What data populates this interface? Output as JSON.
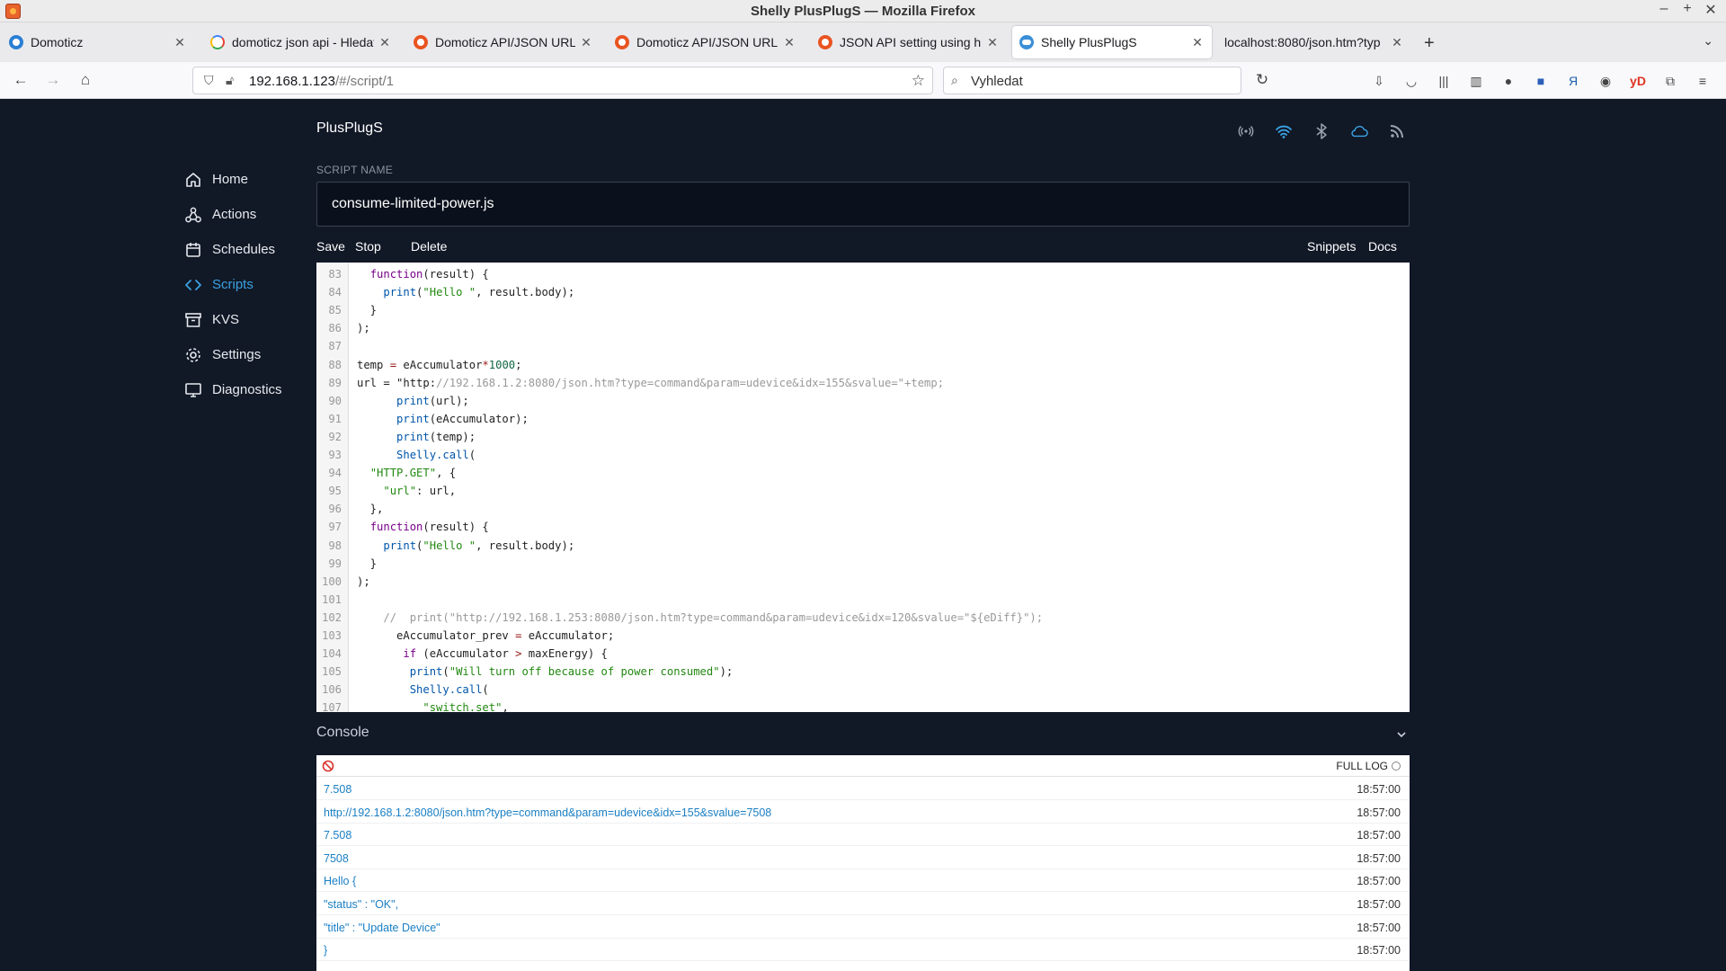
{
  "window": {
    "title": "Shelly PlusPlugS — Mozilla Firefox",
    "controls": [
      "–",
      "+",
      "✕"
    ]
  },
  "tabs": [
    {
      "title": "Domoticz",
      "favicon": "domoticz-icon"
    },
    {
      "title": "domoticz json api - Hledat",
      "favicon": "google-icon"
    },
    {
      "title": "Domoticz API/JSON URL",
      "favicon": "ubuntu-icon"
    },
    {
      "title": "Domoticz API/JSON URL",
      "favicon": "ubuntu-icon"
    },
    {
      "title": "JSON API setting using h",
      "favicon": "ubuntu-icon"
    },
    {
      "title": "Shelly PlusPlugS",
      "favicon": "shelly-icon",
      "active": true
    },
    {
      "title": "localhost:8080/json.htm?typ",
      "favicon": "none"
    }
  ],
  "address": {
    "host": "192.168.1.123",
    "path": "/#/script/1"
  },
  "search": {
    "placeholder": "Vyhledat"
  },
  "app": {
    "device_name": "PlusPlugS",
    "sidebar": [
      {
        "label": "Home",
        "icon": "home-icon"
      },
      {
        "label": "Actions",
        "icon": "actions-icon"
      },
      {
        "label": "Schedules",
        "icon": "calendar-icon"
      },
      {
        "label": "Scripts",
        "icon": "code-icon",
        "active": true
      },
      {
        "label": "KVS",
        "icon": "archive-icon"
      },
      {
        "label": "Settings",
        "icon": "gear-icon"
      },
      {
        "label": "Diagnostics",
        "icon": "monitor-icon"
      }
    ],
    "script_label": "SCRIPT NAME",
    "script_name": "consume-limited-power.js",
    "toolbar": {
      "save": "Save",
      "stop": "Stop",
      "delete": "Delete",
      "snippets": "Snippets",
      "docs": "Docs"
    },
    "code_lines": [
      {
        "n": "83",
        "text": "  function(result) {"
      },
      {
        "n": "84",
        "text": "    print(\"Hello \", result.body);"
      },
      {
        "n": "85",
        "text": "  }"
      },
      {
        "n": "86",
        "text": ");"
      },
      {
        "n": "87",
        "text": ""
      },
      {
        "n": "88",
        "text": "temp = eAccumulator*1000;"
      },
      {
        "n": "89",
        "text": "url = \"http://192.168.1.2:8080/json.htm?type=command&param=udevice&idx=155&svalue=\"+temp;"
      },
      {
        "n": "90",
        "text": "      print(url);"
      },
      {
        "n": "91",
        "text": "      print(eAccumulator);"
      },
      {
        "n": "92",
        "text": "      print(temp);"
      },
      {
        "n": "93",
        "text": "      Shelly.call("
      },
      {
        "n": "94",
        "text": "  \"HTTP.GET\", {"
      },
      {
        "n": "95",
        "text": "    \"url\": url,"
      },
      {
        "n": "96",
        "text": "  },"
      },
      {
        "n": "97",
        "text": "  function(result) {"
      },
      {
        "n": "98",
        "text": "    print(\"Hello \", result.body);"
      },
      {
        "n": "99",
        "text": "  }"
      },
      {
        "n": "100",
        "text": ");"
      },
      {
        "n": "101",
        "text": ""
      },
      {
        "n": "102",
        "text": "    //  print(\"http://192.168.1.253:8080/json.htm?type=command&param=udevice&idx=120&svalue=\"${eDiff}\");"
      },
      {
        "n": "103",
        "text": "      eAccumulator_prev = eAccumulator;"
      },
      {
        "n": "104",
        "text": "       if (eAccumulator > maxEnergy) {"
      },
      {
        "n": "105",
        "text": "        print(\"Will turn off because of power consumed\");"
      },
      {
        "n": "106",
        "text": "        Shelly.call("
      },
      {
        "n": "107",
        "text": "          \"switch.set\","
      }
    ],
    "console": {
      "title": "Console",
      "full_log": "FULL LOG",
      "entries": [
        {
          "msg": "7.508",
          "time": "18:57:00"
        },
        {
          "msg": "http://192.168.1.2:8080/json.htm?type=command&param=udevice&idx=155&svalue=7508",
          "time": "18:57:00"
        },
        {
          "msg": "7.508",
          "time": "18:57:00"
        },
        {
          "msg": "7508",
          "time": "18:57:00"
        },
        {
          "msg": "Hello {",
          "time": "18:57:00"
        },
        {
          "msg": "\"status\" : \"OK\",",
          "time": "18:57:00"
        },
        {
          "msg": "\"title\" : \"Update Device\"",
          "time": "18:57:00"
        },
        {
          "msg": "}",
          "time": "18:57:00"
        }
      ]
    }
  },
  "colors": {
    "app_bg": "#111826",
    "accent": "#3aa3e3",
    "log_text": "#1a7fc4"
  }
}
